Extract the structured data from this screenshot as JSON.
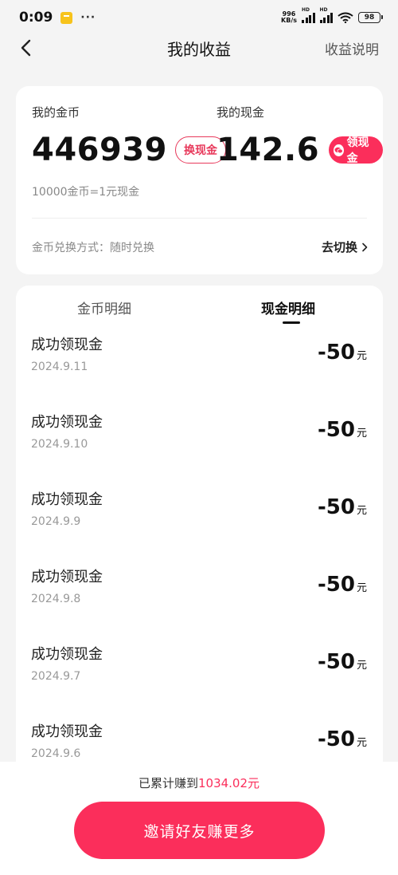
{
  "status_bar": {
    "time": "0:09",
    "more": "···",
    "net_speed_value": "996",
    "net_speed_unit": "KB/s",
    "signal_label": "HD",
    "battery": "98"
  },
  "nav": {
    "title": "我的收益",
    "help": "收益说明"
  },
  "summary": {
    "coin_label": "我的金币",
    "coin_value": "446939",
    "exchange_button": "换现金",
    "cash_label": "我的现金",
    "cash_value": "142.6",
    "withdraw_button": "领现金",
    "rate": "10000金币=1元现金",
    "mode": "金币兑换方式：随时兑换",
    "switch": "去切换"
  },
  "tabs": [
    {
      "label": "金币明细",
      "active": false
    },
    {
      "label": "现金明细",
      "active": true
    }
  ],
  "records": [
    {
      "title": "成功领现金",
      "date": "2024.9.11",
      "amount": "-50",
      "unit": "元"
    },
    {
      "title": "成功领现金",
      "date": "2024.9.10",
      "amount": "-50",
      "unit": "元"
    },
    {
      "title": "成功领现金",
      "date": "2024.9.9",
      "amount": "-50",
      "unit": "元"
    },
    {
      "title": "成功领现金",
      "date": "2024.9.8",
      "amount": "-50",
      "unit": "元"
    },
    {
      "title": "成功领现金",
      "date": "2024.9.7",
      "amount": "-50",
      "unit": "元"
    },
    {
      "title": "成功领现金",
      "date": "2024.9.6",
      "amount": "-50",
      "unit": "元"
    }
  ],
  "footer": {
    "total_prefix": "已累计赚到",
    "total_amount": "1034.02元",
    "invite_button": "邀请好友赚更多"
  },
  "colors": {
    "accent": "#fb2e5b",
    "background": "#f4f4f4"
  }
}
